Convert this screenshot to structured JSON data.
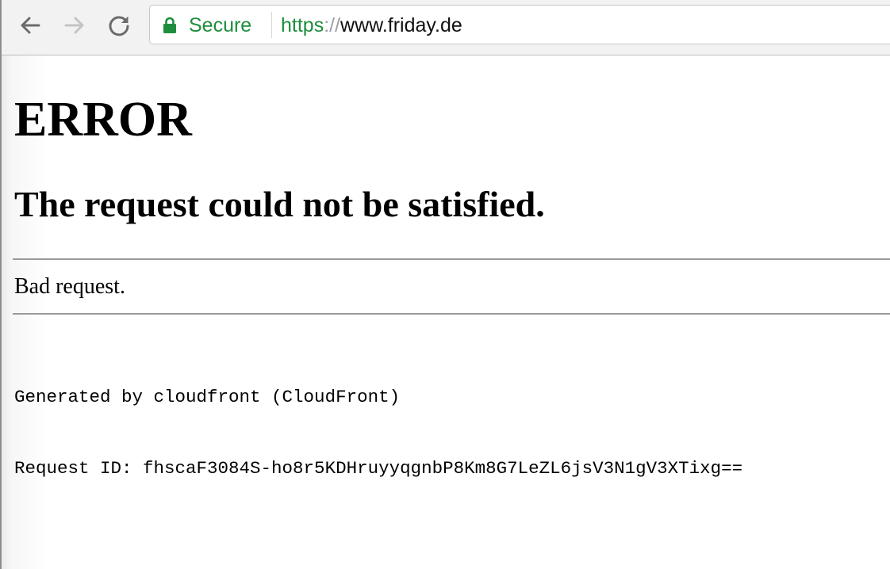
{
  "browser": {
    "nav": {
      "back": "back-arrow-icon",
      "forward": "forward-arrow-icon",
      "reload": "reload-icon"
    },
    "address_bar": {
      "security_icon": "lock-icon",
      "security_label": "Secure",
      "url_scheme": "https",
      "url_separator": "://",
      "url_host": "www.friday.de"
    }
  },
  "page": {
    "heading": "ERROR",
    "subheading": "The request could not be satisfied.",
    "message": "Bad request.",
    "footer_lines": [
      "Generated by cloudfront (CloudFront)",
      "Request ID: fhscaF3084S-ho8r5KDHruyyqgnbP8Km8G7LeZL6jsV3N1gV3XTixg=="
    ]
  },
  "colors": {
    "secure_green": "#1e8e3e",
    "toolbar_bg": "#f2f2f2",
    "rule_gray": "#9a9a9a"
  }
}
